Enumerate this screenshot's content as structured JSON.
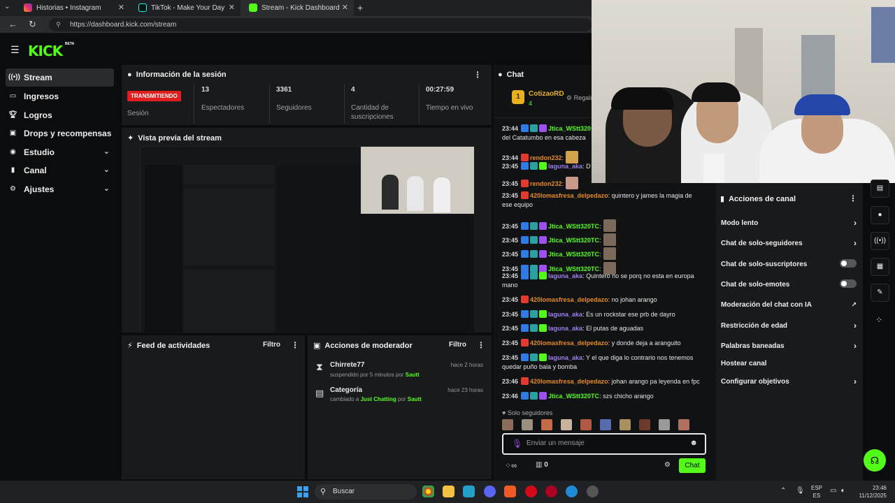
{
  "browser": {
    "tabs": [
      {
        "title": "Historias • Instagram"
      },
      {
        "title": "TikTok - Make Your Day"
      },
      {
        "title": "Stream - Kick Dashboard"
      }
    ],
    "url": "https://dashboard.kick.com/stream"
  },
  "brand": {
    "logo": "KICK",
    "beta": "BETA",
    "accent": "#53fc18"
  },
  "sidebar": {
    "items": [
      {
        "label": "Stream",
        "icon": "broadcast-icon"
      },
      {
        "label": "Ingresos",
        "icon": "money-icon"
      },
      {
        "label": "Logros",
        "icon": "trophy-icon"
      },
      {
        "label": "Drops y recompensas",
        "icon": "gift-icon"
      },
      {
        "label": "Estudio",
        "icon": "studio-icon"
      },
      {
        "label": "Canal",
        "icon": "channel-icon"
      },
      {
        "label": "Ajustes",
        "icon": "gear-icon"
      }
    ]
  },
  "session": {
    "title": "Información de la sesión",
    "status": "TRANSMITIENDO",
    "status_label": "Sesión",
    "stats": [
      {
        "value": "13",
        "label": "Espectadores"
      },
      {
        "value": "3361",
        "label": "Seguidores"
      },
      {
        "value": "4",
        "label": "Cantidad de suscripciones"
      },
      {
        "value": "00:27:59",
        "label": "Tiempo en vivo"
      }
    ]
  },
  "preview": {
    "title": "Vista previa del stream"
  },
  "activity": {
    "title": "Feed de actividades",
    "filter": "Filtro"
  },
  "modactions": {
    "title": "Acciones de moderador",
    "filter": "Filtro",
    "items": [
      {
        "name": "Chirrete77",
        "time": "hace 2 horas",
        "action": "suspendido por 5 minutos por",
        "by": "Sautt"
      },
      {
        "name": "Categoría",
        "time": "hace 23 horas",
        "action": "cambiado a",
        "target": "Just Chatting",
        "by_prefix": "por",
        "by": "Sautt"
      }
    ]
  },
  "chat": {
    "title": "Chat",
    "pinned_user": "CotizaoRD",
    "pinned_count": "4",
    "pinned_extra": "Regala",
    "messages": [
      {
        "time": "23:44",
        "user": "Jtica_WStt320",
        "text": ":",
        "cont": "del Catatumbo en esa cabeza",
        "color": "#53fc18"
      },
      {
        "time": "23:44",
        "user": "rendon232",
        "text": ":",
        "color": "#e58a1f"
      },
      {
        "time": "23:45",
        "user": "laguna_aka",
        "text": ": D",
        "color": "#9d7ff0"
      },
      {
        "time": "23:45",
        "user": "rendon232",
        "text": ":",
        "color": "#e58a1f"
      },
      {
        "time": "23:45",
        "user": "420lomasfresa_delpedazo",
        "text": ": quintero y james la magia de",
        "cont": "ese equipo",
        "color": "#e58a1f"
      },
      {
        "time": "23:45",
        "user": "Jtica_WStt320TC",
        "text": ":",
        "color": "#53fc18"
      },
      {
        "time": "23:45",
        "user": "Jtica_WStt320TC",
        "text": ":",
        "color": "#53fc18"
      },
      {
        "time": "23:45",
        "user": "Jtica_WStt320TC",
        "text": ":",
        "color": "#53fc18"
      },
      {
        "time": "23:45",
        "user": "Jtica_WStt320TC",
        "text": ":",
        "color": "#53fc18"
      },
      {
        "time": "23:45",
        "user": "laguna_aka",
        "text": ": Quintero no se porq no esta en europa",
        "cont": "mano",
        "color": "#9d7ff0"
      },
      {
        "time": "23:45",
        "user": "420lomasfresa_delpedazo",
        "text": ": no johan arango",
        "color": "#e58a1f"
      },
      {
        "time": "23:45",
        "user": "laguna_aka",
        "text": ": Es un rockstar ese prb de dayro",
        "color": "#9d7ff0"
      },
      {
        "time": "23:45",
        "user": "laguna_aka",
        "text": ": El putas de aguadas",
        "color": "#9d7ff0"
      },
      {
        "time": "23:45",
        "user": "420lomasfresa_delpedazo",
        "text": ": y donde deja a aranguito",
        "color": "#e58a1f"
      },
      {
        "time": "23:45",
        "user": "laguna_aka",
        "text": ": Y el que diga lo contrario nos tenemos",
        "cont": "quedar puño bala y bomba",
        "color": "#9d7ff0"
      },
      {
        "time": "23:46",
        "user": "420lomasfresa_delpedazo",
        "text": ": johan arango pa leyenda en fpc",
        "color": "#e58a1f"
      },
      {
        "time": "23:46",
        "user": "Jtica_WStt320TC",
        "text": ": szs chicho arango",
        "color": "#53fc18"
      }
    ],
    "followers_only": "Solo seguidores",
    "input_placeholder": "Enviar un mensaje",
    "points": "0",
    "send": "Chat"
  },
  "channel_actions": {
    "title": "Acciones de canal",
    "items": [
      {
        "label": "Modo lento",
        "kind": "chevron"
      },
      {
        "label": "Chat de solo-seguidores",
        "kind": "chevron"
      },
      {
        "label": "Chat de solo-suscriptores",
        "kind": "toggle"
      },
      {
        "label": "Chat de solo-emotes",
        "kind": "toggle"
      },
      {
        "label": "Moderación del chat con IA",
        "kind": "external"
      },
      {
        "label": "Restricción de edad",
        "kind": "chevron"
      },
      {
        "label": "Palabras baneadas",
        "kind": "chevron"
      },
      {
        "label": "Hostear canal",
        "kind": "none"
      },
      {
        "label": "Configurar objetivos",
        "kind": "chevron"
      }
    ]
  },
  "taskbar": {
    "search": "Buscar",
    "lang": "ESP",
    "lang2": "ES",
    "time": "23:46",
    "date": "11/12/2025"
  }
}
